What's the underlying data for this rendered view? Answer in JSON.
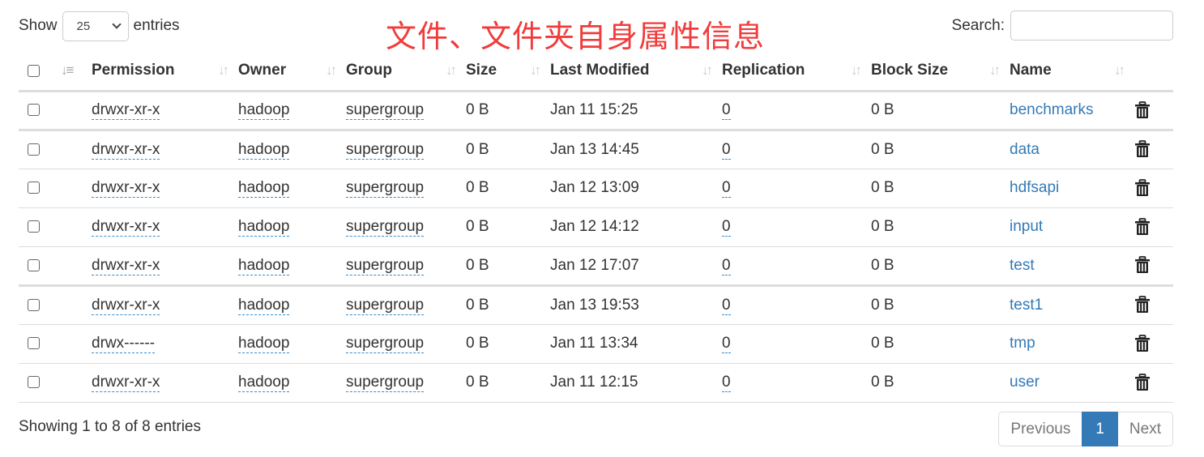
{
  "controls": {
    "show_label": "Show",
    "entries_label": "entries",
    "page_length": "25",
    "search_label": "Search:",
    "search_value": "",
    "search_placeholder": ""
  },
  "annotation": "文件、文件夹自身属性信息",
  "annotation_color": "#f03c3c",
  "accent_color": "#337ab7",
  "table": {
    "columns": [
      "Permission",
      "Owner",
      "Group",
      "Size",
      "Last Modified",
      "Replication",
      "Block Size",
      "Name"
    ],
    "rows": [
      {
        "permission": "drwxr-xr-x",
        "owner": "hadoop",
        "group": "supergroup",
        "size": "0 B",
        "modified": "Jan 11 15:25",
        "replication": "0",
        "block_size": "0 B",
        "name": "benchmarks"
      },
      {
        "permission": "drwxr-xr-x",
        "owner": "hadoop",
        "group": "supergroup",
        "size": "0 B",
        "modified": "Jan 13 14:45",
        "replication": "0",
        "block_size": "0 B",
        "name": "data"
      },
      {
        "permission": "drwxr-xr-x",
        "owner": "hadoop",
        "group": "supergroup",
        "size": "0 B",
        "modified": "Jan 12 13:09",
        "replication": "0",
        "block_size": "0 B",
        "name": "hdfsapi"
      },
      {
        "permission": "drwxr-xr-x",
        "owner": "hadoop",
        "group": "supergroup",
        "size": "0 B",
        "modified": "Jan 12 14:12",
        "replication": "0",
        "block_size": "0 B",
        "name": "input"
      },
      {
        "permission": "drwxr-xr-x",
        "owner": "hadoop",
        "group": "supergroup",
        "size": "0 B",
        "modified": "Jan 12 17:07",
        "replication": "0",
        "block_size": "0 B",
        "name": "test"
      },
      {
        "permission": "drwxr-xr-x",
        "owner": "hadoop",
        "group": "supergroup",
        "size": "0 B",
        "modified": "Jan 13 19:53",
        "replication": "0",
        "block_size": "0 B",
        "name": "test1"
      },
      {
        "permission": "drwx------",
        "owner": "hadoop",
        "group": "supergroup",
        "size": "0 B",
        "modified": "Jan 11 13:34",
        "replication": "0",
        "block_size": "0 B",
        "name": "tmp"
      },
      {
        "permission": "drwxr-xr-x",
        "owner": "hadoop",
        "group": "supergroup",
        "size": "0 B",
        "modified": "Jan 11 12:15",
        "replication": "0",
        "block_size": "0 B",
        "name": "user"
      }
    ]
  },
  "footer": {
    "info": "Showing 1 to 8 of 8 entries",
    "previous": "Previous",
    "current_page": "1",
    "next": "Next"
  }
}
